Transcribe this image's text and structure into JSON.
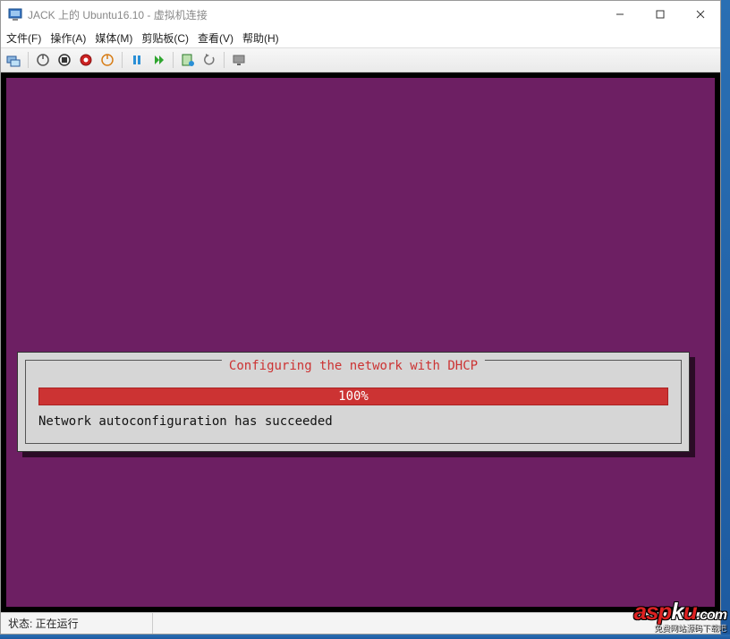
{
  "window": {
    "title": "JACK 上的 Ubuntu16.10 - 虚拟机连接"
  },
  "menu": {
    "file": "文件(F)",
    "action": "操作(A)",
    "media": "媒体(M)",
    "clipboard": "剪贴板(C)",
    "view": "查看(V)",
    "help": "帮助(H)"
  },
  "dialog": {
    "title": "Configuring the network with DHCP",
    "progress_label": "100%",
    "status": "Network autoconfiguration has succeeded"
  },
  "statusbar": {
    "state": "状态: 正在运行"
  },
  "watermark": {
    "text_prefix": "asp",
    "text_mid": "k",
    "text_suffix": "u",
    "text_tld": ".com",
    "subtitle": "免费网站源码下载吧"
  }
}
